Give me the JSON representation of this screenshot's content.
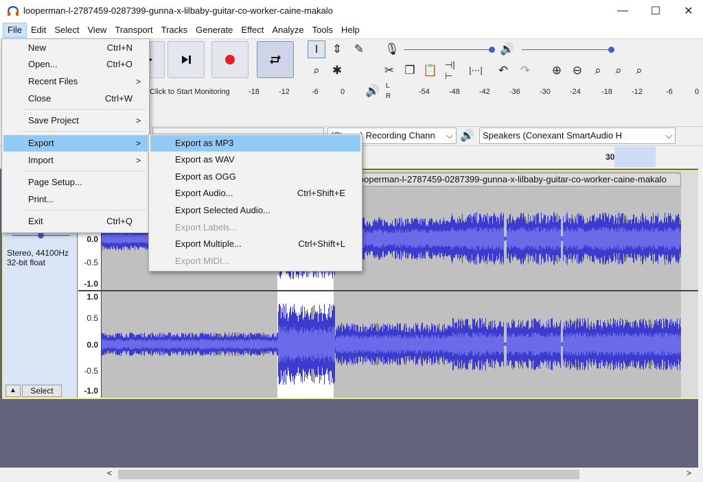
{
  "window": {
    "title": "looperman-l-2787459-0287399-gunna-x-lilbaby-guitar-co-worker-caine-makalo",
    "minimize": "—",
    "maximize": "☐",
    "close": "✕"
  },
  "menubar": [
    "File",
    "Edit",
    "Select",
    "View",
    "Transport",
    "Tracks",
    "Generate",
    "Effect",
    "Analyze",
    "Tools",
    "Help"
  ],
  "file_menu": [
    {
      "label": "New",
      "shortcut": "Ctrl+N"
    },
    {
      "label": "Open...",
      "shortcut": "Ctrl+O"
    },
    {
      "label": "Recent Files",
      "submenu": ">"
    },
    {
      "label": "Close",
      "shortcut": "Ctrl+W"
    },
    {
      "label": "Save Project",
      "submenu": ">"
    },
    {
      "label": "Export",
      "submenu": ">"
    },
    {
      "label": "Import",
      "submenu": ">"
    },
    {
      "label": "Page Setup..."
    },
    {
      "label": "Print..."
    },
    {
      "label": "Exit",
      "shortcut": "Ctrl+Q"
    }
  ],
  "export_menu": [
    {
      "label": "Export as MP3"
    },
    {
      "label": "Export as WAV"
    },
    {
      "label": "Export as OGG"
    },
    {
      "label": "Export Audio...",
      "shortcut": "Ctrl+Shift+E"
    },
    {
      "label": "Export Selected Audio..."
    },
    {
      "label": "Export Labels..."
    },
    {
      "label": "Export Multiple...",
      "shortcut": "Ctrl+Shift+L"
    },
    {
      "label": "Export MIDI..."
    }
  ],
  "meter": {
    "record_ticks": [
      "-18",
      "-12",
      "-6",
      "0"
    ],
    "monitor_hint": "Click to Start Monitoring",
    "play_ticks": [
      "-54",
      "-48",
      "-42",
      "-36",
      "-30",
      "-24",
      "-18",
      "-12",
      "-6",
      "0"
    ],
    "lr": [
      "L",
      "R"
    ]
  },
  "devices": {
    "recording_channels": "(Stereo) Recording Chann",
    "speaker": "Speakers (Conexant SmartAudio H"
  },
  "timeline": {
    "label": "30"
  },
  "track": {
    "clip_name": "looperman-l-2787459-0287399-gunna-x-lilbaby-guitar-co-worker-caine-makalo",
    "info_rate": "Stereo, 44100Hz",
    "info_format": "32-bit float",
    "select_label": "Select",
    "scale_ch1": [
      "0.0",
      "-0.5",
      "-1.0"
    ],
    "scale_ch2": [
      "1.0",
      "0.5",
      "0.0",
      "-0.5",
      "-1.0"
    ]
  },
  "colors": {
    "waveform": "#3b3bd0",
    "waveform_rms": "#6b6bea",
    "selection": "#ffffff",
    "accent": "#91c9f7"
  }
}
